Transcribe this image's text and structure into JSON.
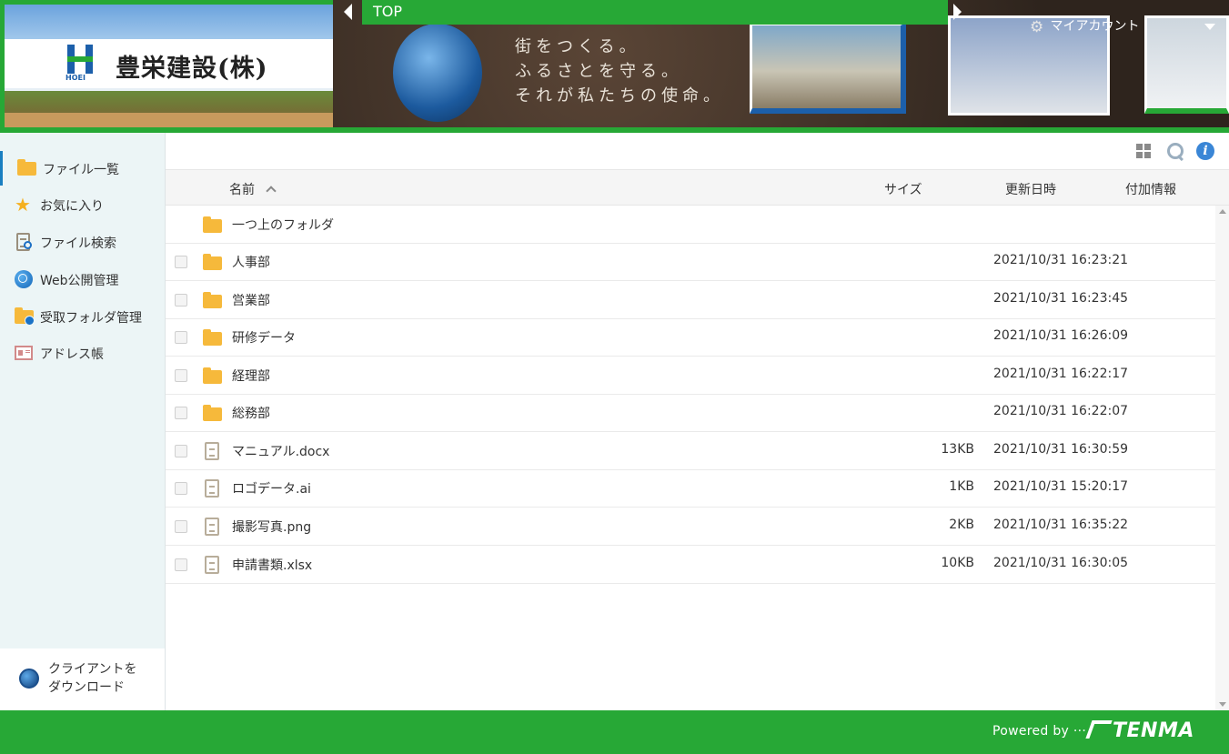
{
  "header": {
    "company_name": "豊栄建設(株)",
    "logo_text": "HOEI",
    "tagline": [
      "街をつくる。",
      "ふるさとを守る。",
      "それが私たちの使命。"
    ],
    "top_label": "TOP",
    "account_label": "マイアカウント"
  },
  "sidebar": {
    "items": [
      {
        "label": "ファイル一覧",
        "icon": "folder-icon",
        "active": true
      },
      {
        "label": "お気に入り",
        "icon": "star-icon"
      },
      {
        "label": "ファイル検索",
        "icon": "file-search-icon"
      },
      {
        "label": "Web公開管理",
        "icon": "globe-icon"
      },
      {
        "label": "受取フォルダ管理",
        "icon": "folder-globe-icon"
      },
      {
        "label": "アドレス帳",
        "icon": "address-card-icon"
      }
    ],
    "download_line1": "クライアントを",
    "download_line2": "ダウンロード"
  },
  "table": {
    "columns": {
      "name": "名前",
      "size": "サイズ",
      "date": "更新日時",
      "extra": "付加情報"
    },
    "parent_folder": "一つ上のフォルダ",
    "rows": [
      {
        "name": "人事部",
        "type": "folder",
        "size": "",
        "date": "2021/10/31 16:23:21"
      },
      {
        "name": "営業部",
        "type": "folder",
        "size": "",
        "date": "2021/10/31 16:23:45"
      },
      {
        "name": "研修データ",
        "type": "folder",
        "size": "",
        "date": "2021/10/31 16:26:09"
      },
      {
        "name": "経理部",
        "type": "folder",
        "size": "",
        "date": "2021/10/31 16:22:17"
      },
      {
        "name": "総務部",
        "type": "folder",
        "size": "",
        "date": "2021/10/31 16:22:07"
      },
      {
        "name": "マニュアル.docx",
        "type": "file",
        "size": "13KB",
        "date": "2021/10/31 16:30:59"
      },
      {
        "name": "ロゴデータ.ai",
        "type": "file",
        "size": "1KB",
        "date": "2021/10/31 15:20:17"
      },
      {
        "name": "撮影写真.png",
        "type": "file",
        "size": "2KB",
        "date": "2021/10/31 16:35:22"
      },
      {
        "name": "申請書類.xlsx",
        "type": "file",
        "size": "10KB",
        "date": "2021/10/31 16:30:05"
      }
    ]
  },
  "footer": {
    "powered_by": "Powered by ···",
    "brand": "TENMA"
  },
  "colors": {
    "brand_green": "#27a836",
    "sidebar_bg": "#ecf5f6",
    "folder": "#f6b93b",
    "accent_blue": "#1a7fc1"
  }
}
